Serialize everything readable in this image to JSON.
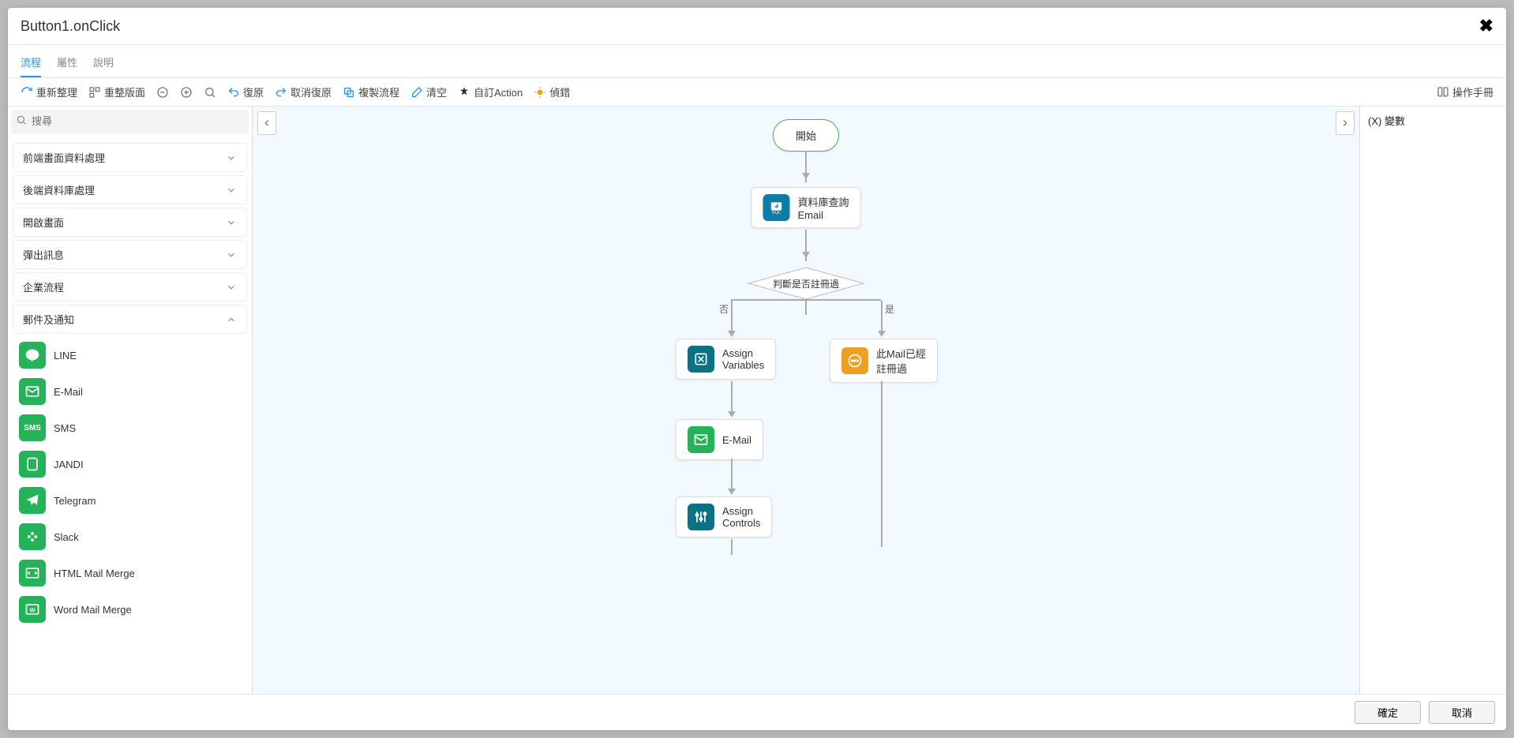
{
  "modal": {
    "title": "Button1.onClick"
  },
  "tabs": {
    "flow": "流程",
    "attrs": "屬性",
    "help": "說明"
  },
  "toolbar": {
    "refresh": "重新整理",
    "relayout": "重整版面",
    "undo": "復原",
    "redo": "取消復原",
    "copy": "複製流程",
    "clear": "清空",
    "custom": "自訂Action",
    "debug": "偵錯",
    "manual": "操作手冊"
  },
  "search": {
    "placeholder": "搜尋"
  },
  "categories": {
    "c1": "前端畫面資料處理",
    "c2": "後端資料庫處理",
    "c3": "開啟畫面",
    "c4": "彈出訊息",
    "c5": "企業流程",
    "c6": "郵件及通知"
  },
  "actions": {
    "line": "LINE",
    "email": "E-Mail",
    "sms": "SMS",
    "jandi": "JANDI",
    "telegram": "Telegram",
    "slack": "Slack",
    "htmlmm": "HTML Mail Merge",
    "wordmm": "Word Mail Merge"
  },
  "flow": {
    "start": "開始",
    "dbquery_line1": "資料庫查詢",
    "dbquery_line2": "Email",
    "decision": "判斷是否註冊過",
    "branch_no": "否",
    "branch_yes": "是",
    "assignvar_line1": "Assign",
    "assignvar_line2": "Variables",
    "alreadyreg_line1": "此Mail已經",
    "alreadyreg_line2": "註冊過",
    "emailnode": "E-Mail",
    "assignctl_line1": "Assign",
    "assignctl_line2": "Controls"
  },
  "rightpane": {
    "vars": "(X) 變數"
  },
  "footer": {
    "ok": "確定",
    "cancel": "取消"
  }
}
